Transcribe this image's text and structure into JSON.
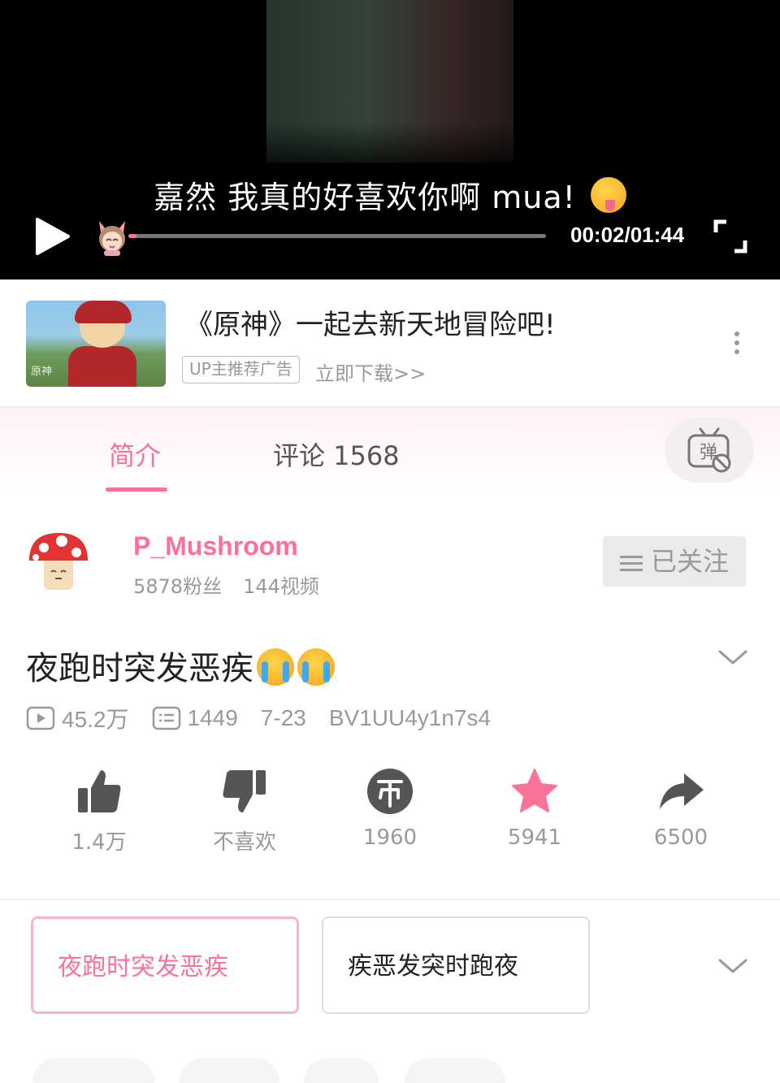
{
  "player": {
    "subtitle": "嘉然 我真的好喜欢你啊 mua!",
    "time": "00:02/01:44",
    "progress_fraction": 0.02,
    "accent": "#fb7299"
  },
  "ad": {
    "title": "《原神》一起去新天地冒险吧!",
    "tag": "UP主推荐广告",
    "link": "立即下载>>",
    "thumb_logo": "原神"
  },
  "tabs": {
    "intro": "简介",
    "comments": "评论 1568"
  },
  "uploader": {
    "name": "P_Mushroom",
    "fans": "5878粉丝",
    "videos": "144视频",
    "follow_label": "已关注"
  },
  "video": {
    "title": "夜跑时突发恶疾",
    "views": "45.2万",
    "danmaku": "1449",
    "date": "7-23",
    "bvid": "BV1UU4y1n7s4"
  },
  "actions": {
    "like": "1.4万",
    "dislike": "不喜欢",
    "coin": "1960",
    "favorite": "5941",
    "share": "6500"
  },
  "parts": [
    {
      "label": "夜跑时突发恶疾"
    },
    {
      "label": "疾恶发突时跑夜"
    }
  ],
  "icons": [
    "play-icon",
    "fullscreen-icon",
    "danmaku-icon",
    "like-icon",
    "dislike-icon",
    "coin-icon",
    "star-icon",
    "share-icon",
    "chevron-down-icon",
    "menu-icon",
    "more-icon"
  ]
}
